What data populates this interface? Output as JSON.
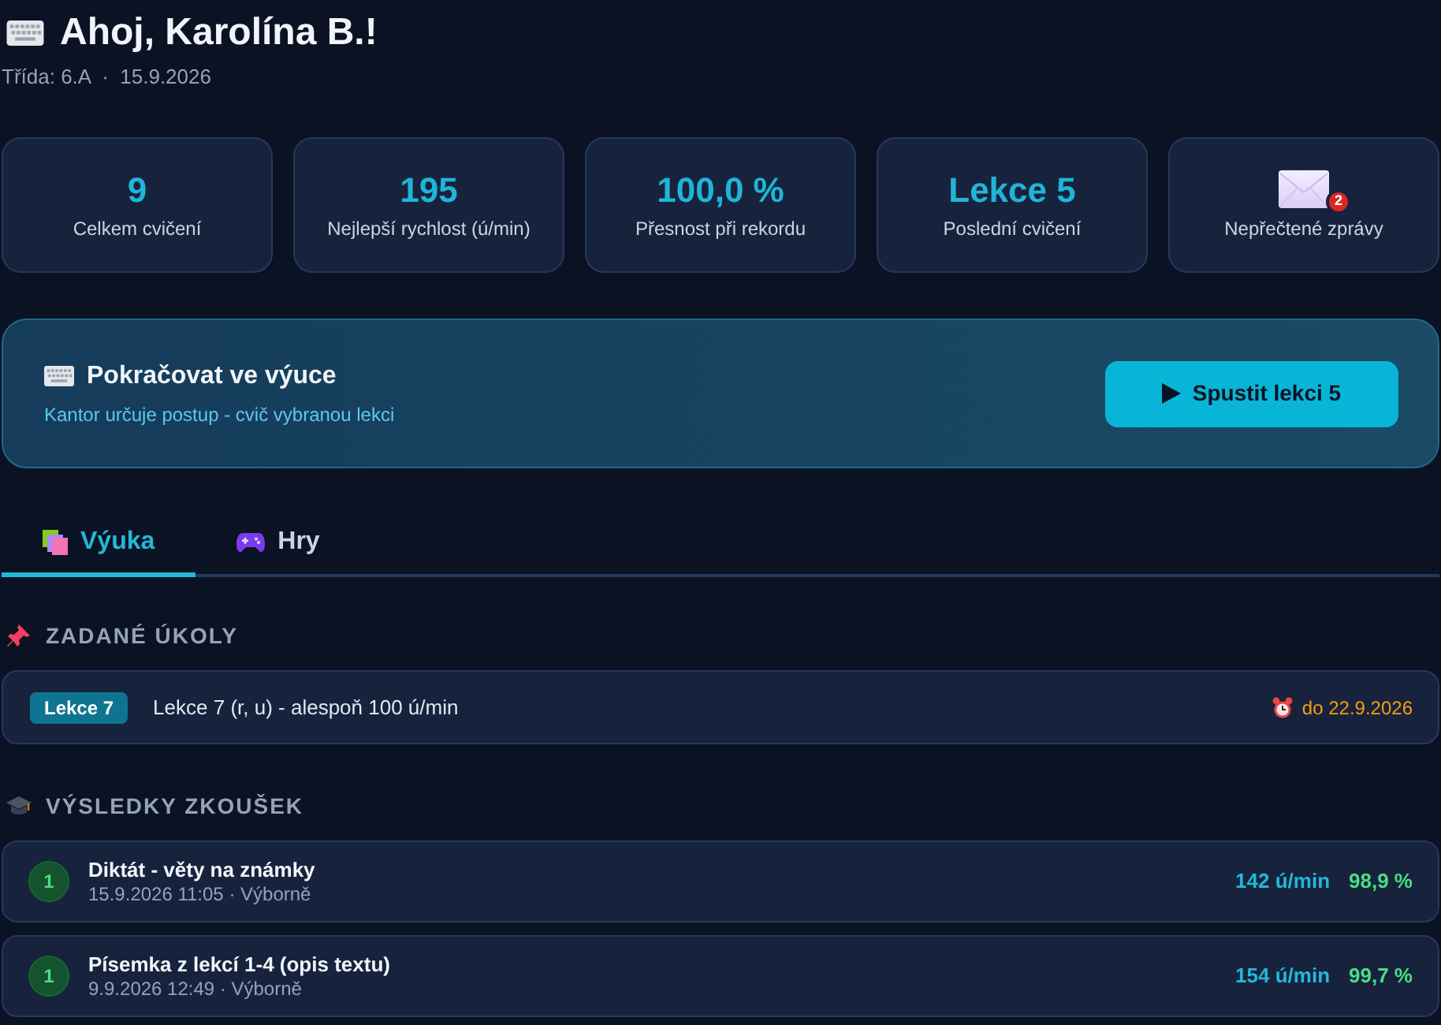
{
  "header": {
    "greeting": "Ahoj, Karolína B.!",
    "subtitle": "Třída: 6.A  ·  15.9.2026"
  },
  "stats": [
    {
      "kind": "value",
      "value": "9",
      "label": "Celkem cvičení"
    },
    {
      "kind": "value",
      "value": "195",
      "label": "Nejlepší rychlost (ú/min)"
    },
    {
      "kind": "value",
      "value": "100,0 %",
      "label": "Přesnost při rekordu"
    },
    {
      "kind": "value",
      "value": "Lekce 5",
      "label": "Poslední cvičení"
    },
    {
      "kind": "messages",
      "badge": "2",
      "label": "Nepřečtené zprávy"
    }
  ],
  "continue_banner": {
    "title": "Pokračovat ve výuce",
    "subtitle": "Kantor určuje postup - cvič vybranou lekci",
    "button": "Spustit lekci 5"
  },
  "tabs": [
    {
      "kind": "lessons",
      "label": "Výuka",
      "selected": true
    },
    {
      "kind": "games",
      "label": "Hry",
      "selected": false
    }
  ],
  "assignments": {
    "title": "ZADANÉ ÚKOLY",
    "items": [
      {
        "badge": "Lekce 7",
        "text": "Lekce 7 (r, u) - alespoň 100 ú/min",
        "due": "do 22.9.2026"
      }
    ]
  },
  "exam_results": {
    "title": "VÝSLEDKY ZKOUŠEK",
    "items": [
      {
        "grade": "1",
        "title": "Diktát - věty na známky",
        "meta": "15.9.2026 11:05 · Výborně",
        "speed": "142 ú/min",
        "accuracy": "98,9 %"
      },
      {
        "grade": "1",
        "title": "Písemka z lekcí 1-4 (opis textu)",
        "meta": "9.9.2026 12:49 · Výborně",
        "speed": "154 ú/min",
        "accuracy": "99,7 %"
      }
    ]
  }
}
